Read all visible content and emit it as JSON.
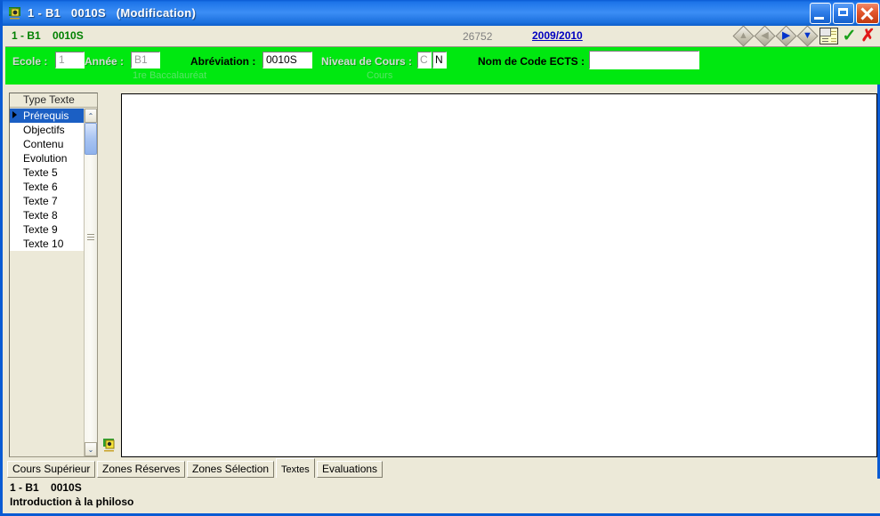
{
  "window": {
    "title": "1 - B1   0010S   (Modification)",
    "app_icon": "app-icon",
    "controls": {
      "minimize_label": "_",
      "maximize_label": "□",
      "close_label": "✕"
    },
    "accent_color": "#0a5bd3",
    "form_color": "#00e810",
    "face_color": "#ece9d8"
  },
  "recordbar": {
    "code": "1 - B1    0010S",
    "record_number": "26752",
    "academic_year": "2009/2010",
    "nav": [
      {
        "name": "first-record-button",
        "glyph": "▲",
        "style": "gray"
      },
      {
        "name": "previous-record-button",
        "glyph": "◀",
        "style": "gray"
      },
      {
        "name": "next-record-button",
        "glyph": "▶",
        "style": "blue"
      },
      {
        "name": "last-record-button",
        "glyph": "▼",
        "style": "blue"
      }
    ],
    "list_view_label": "list-view-icon",
    "confirm_label": "✓",
    "cancel_label": "✗"
  },
  "form": {
    "ecole": {
      "label": "Ecole :",
      "value": "1"
    },
    "annee": {
      "label": "Année :",
      "value": "B1",
      "sublabel": "1re Baccalauréat"
    },
    "abreviation": {
      "label": "Abréviation :",
      "value": "0010S"
    },
    "niveau": {
      "label": "Niveau de Cours :",
      "value_code": "C",
      "value_flag": "N",
      "sublabel": "Cours"
    },
    "ects": {
      "label": "Nom de Code ECTS :",
      "value": "",
      "placeholder": ""
    }
  },
  "list": {
    "header": "Type Texte",
    "rows": [
      {
        "label": "Prérequis",
        "selected": true
      },
      {
        "label": "Objectifs",
        "selected": false
      },
      {
        "label": "Contenu",
        "selected": false
      },
      {
        "label": "Evolution",
        "selected": false
      },
      {
        "label": "Texte 5",
        "selected": false
      },
      {
        "label": "Texte 6",
        "selected": false
      },
      {
        "label": "Texte 7",
        "selected": false
      },
      {
        "label": "Texte 8",
        "selected": false
      },
      {
        "label": "Texte 9",
        "selected": false
      },
      {
        "label": "Texte 10",
        "selected": false
      }
    ],
    "scroll_up": "⌃",
    "scroll_down": "⌄"
  },
  "editor": {
    "content": ""
  },
  "tabs": [
    {
      "label": "Cours Supérieur",
      "active": false
    },
    {
      "label": "Zones Réserves",
      "active": false
    },
    {
      "label": "Zones Sélection",
      "active": false
    },
    {
      "label": "Textes",
      "active": true
    },
    {
      "label": "Evaluations",
      "active": false
    }
  ],
  "status": {
    "line1": "1 - B1    0010S",
    "line2": "Introduction à la philoso"
  }
}
